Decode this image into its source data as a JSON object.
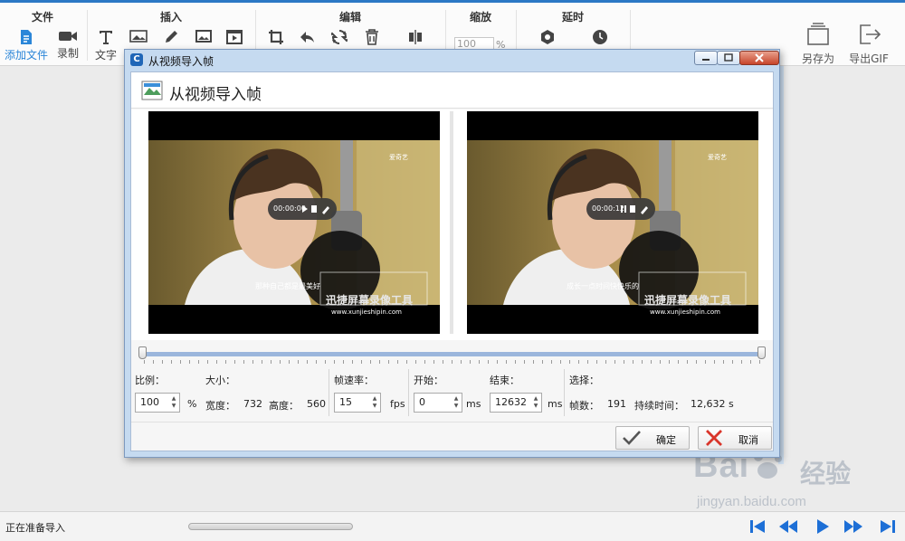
{
  "ribbon": {
    "groups": {
      "file": "文件",
      "insert": "插入",
      "edit": "编辑",
      "zoom": "缩放",
      "delay": "延时"
    },
    "buttons": {
      "add_file": "添加文件",
      "record": "录制",
      "text": "文字",
      "save_as": "另存为",
      "export_gif": "导出GIF"
    },
    "zoom": {
      "value": "100",
      "unit": "%"
    }
  },
  "dialog": {
    "title": "从视频导入帧",
    "header": "从视频导入帧",
    "frames": {
      "left": {
        "timestamp": "00:00:00",
        "logo": "爱奇艺",
        "subtitle": "那种自己都是最美好",
        "watermark_title": "迅捷屏幕录像工具",
        "watermark_url": "www.xunjieshipin.com"
      },
      "right": {
        "timestamp": "00:00:12",
        "logo": "爱奇艺",
        "subtitle": "成长一点时间快快乐的",
        "watermark_title": "迅捷屏幕录像工具",
        "watermark_url": "www.xunjieshipin.com"
      }
    },
    "params": {
      "ratio_label": "比例：",
      "size_label": "大小：",
      "fps_label": "帧速率：",
      "start_label": "开始：",
      "end_label": "结束：",
      "select_label": "选择：",
      "ratio_value": "100",
      "ratio_unit": "%",
      "width_label": "宽度：",
      "width_value": "732",
      "height_label": "高度：",
      "height_value": "560",
      "fps_value": "15",
      "fps_unit": "fps",
      "start_value": "0",
      "start_unit": "ms",
      "end_value": "12632",
      "end_unit": "ms",
      "frames_label": "帧数：",
      "frames_value": "191",
      "duration_label": "持续时间：",
      "duration_value": "12,632 s"
    },
    "ok_label": "确定",
    "cancel_label": "取消"
  },
  "status": {
    "text": "正在准备导入"
  },
  "watermark": {
    "brand": "Bai",
    "brand_cn": "经验",
    "url": "jingyan.baidu.com"
  },
  "colors": {
    "accent": "#2b86d8",
    "nav": "#1d6fd6",
    "cancel": "#d9352a",
    "ok": "#555555"
  }
}
